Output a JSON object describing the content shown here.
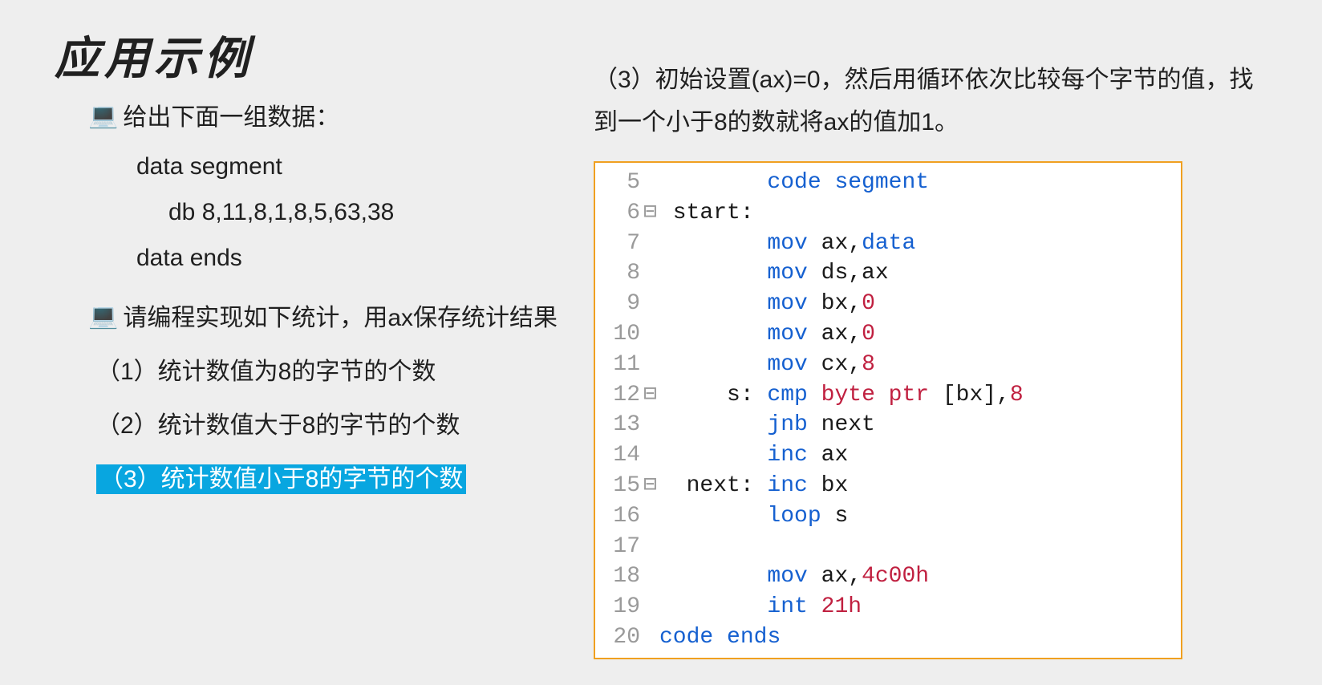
{
  "title": "应用示例",
  "left": {
    "intro": "给出下面一组数据：",
    "code1": "data segment",
    "code2": "db 8,11,8,1,8,5,63,38",
    "code3": "data ends",
    "task_intro": "请编程实现如下统计，用ax保存统计结果",
    "item1": "（1）统计数值为8的字节的个数",
    "item2": "（2）统计数值大于8的字节的个数",
    "item3": "（3）统计数值小于8的字节的个数"
  },
  "right": {
    "desc": "（3）初始设置(ax)=0，然后用循环依次比较每个字节的值，找到一个小于8的数就将ax的值加1。"
  },
  "code_lines": [
    {
      "ln": "5",
      "fold": " ",
      "label": "",
      "body": [
        {
          "t": "kw",
          "s": "code"
        },
        {
          "t": "plain",
          "s": " "
        },
        {
          "t": "kw",
          "s": "segment"
        }
      ]
    },
    {
      "ln": "6",
      "fold": "⊟",
      "label": "start:",
      "body": []
    },
    {
      "ln": "7",
      "fold": " ",
      "label": "",
      "body": [
        {
          "t": "kw",
          "s": "mov"
        },
        {
          "t": "plain",
          "s": " ax,"
        },
        {
          "t": "kw",
          "s": "data"
        }
      ]
    },
    {
      "ln": "8",
      "fold": " ",
      "label": "",
      "body": [
        {
          "t": "kw",
          "s": "mov"
        },
        {
          "t": "plain",
          "s": " ds,ax"
        }
      ]
    },
    {
      "ln": "9",
      "fold": " ",
      "label": "",
      "body": [
        {
          "t": "kw",
          "s": "mov"
        },
        {
          "t": "plain",
          "s": " bx,"
        },
        {
          "t": "num",
          "s": "0"
        }
      ]
    },
    {
      "ln": "10",
      "fold": " ",
      "label": "",
      "body": [
        {
          "t": "kw",
          "s": "mov"
        },
        {
          "t": "plain",
          "s": " ax,"
        },
        {
          "t": "num",
          "s": "0"
        }
      ]
    },
    {
      "ln": "11",
      "fold": " ",
      "label": "",
      "body": [
        {
          "t": "kw",
          "s": "mov"
        },
        {
          "t": "plain",
          "s": " cx,"
        },
        {
          "t": "num",
          "s": "8"
        }
      ]
    },
    {
      "ln": "12",
      "fold": "⊟",
      "label": "s:",
      "body": [
        {
          "t": "kw",
          "s": "cmp"
        },
        {
          "t": "plain",
          "s": " "
        },
        {
          "t": "ptr",
          "s": "byte ptr"
        },
        {
          "t": "plain",
          "s": " [bx],"
        },
        {
          "t": "num",
          "s": "8"
        }
      ]
    },
    {
      "ln": "13",
      "fold": " ",
      "label": "",
      "body": [
        {
          "t": "kw",
          "s": "jnb"
        },
        {
          "t": "plain",
          "s": " next"
        }
      ]
    },
    {
      "ln": "14",
      "fold": " ",
      "label": "",
      "body": [
        {
          "t": "kw",
          "s": "inc"
        },
        {
          "t": "plain",
          "s": " ax"
        }
      ]
    },
    {
      "ln": "15",
      "fold": "⊟",
      "label": "next:",
      "body": [
        {
          "t": "kw",
          "s": "inc"
        },
        {
          "t": "plain",
          "s": " bx"
        }
      ]
    },
    {
      "ln": "16",
      "fold": " ",
      "label": "",
      "body": [
        {
          "t": "kw",
          "s": "loop"
        },
        {
          "t": "plain",
          "s": " s"
        }
      ]
    },
    {
      "ln": "17",
      "fold": " ",
      "label": "",
      "body": []
    },
    {
      "ln": "18",
      "fold": " ",
      "label": "",
      "body": [
        {
          "t": "kw",
          "s": "mov"
        },
        {
          "t": "plain",
          "s": " ax,"
        },
        {
          "t": "num",
          "s": "4c00h"
        }
      ]
    },
    {
      "ln": "19",
      "fold": " ",
      "label": "",
      "body": [
        {
          "t": "kw",
          "s": "int"
        },
        {
          "t": "plain",
          "s": " "
        },
        {
          "t": "num",
          "s": "21h"
        }
      ]
    },
    {
      "ln": "20",
      "fold": " ",
      "label": "",
      "body": [
        {
          "t": "kw",
          "s": "code"
        },
        {
          "t": "plain",
          "s": " "
        },
        {
          "t": "kw",
          "s": "ends"
        }
      ],
      "noLabelPad": true
    }
  ]
}
